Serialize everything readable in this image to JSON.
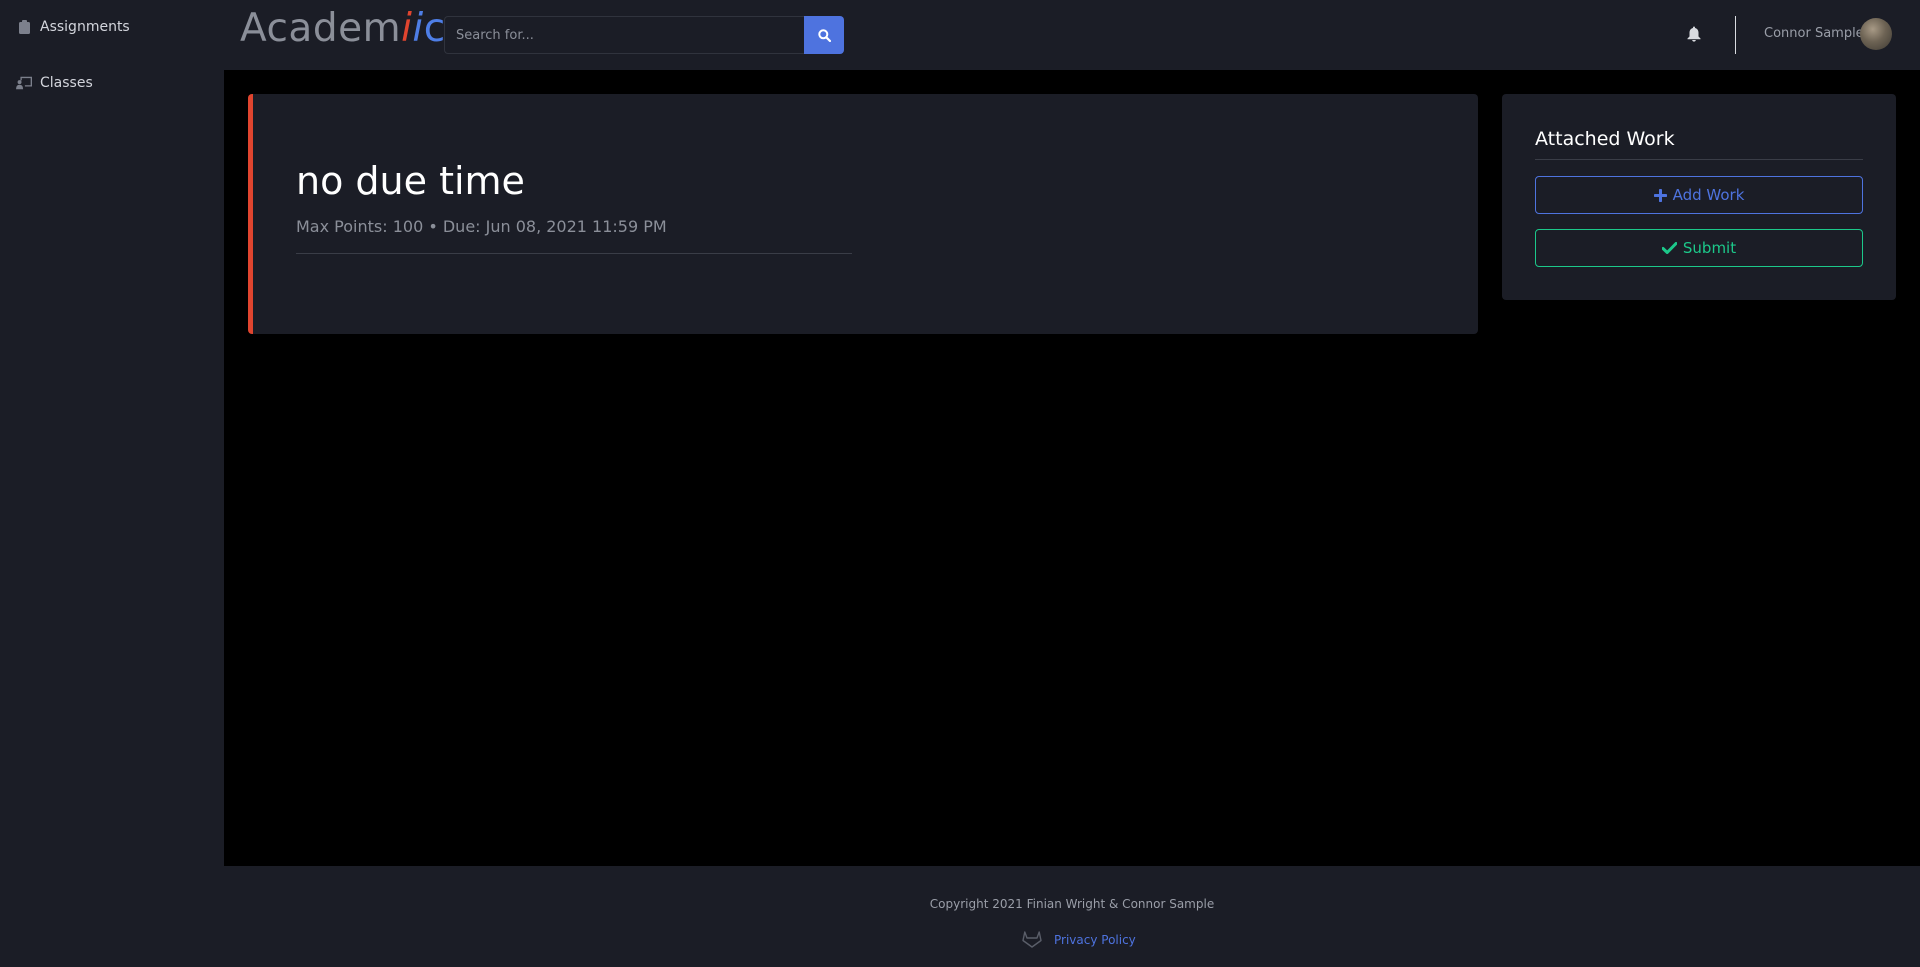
{
  "sidebar": {
    "items": [
      {
        "label": "Assignments",
        "icon": "clipboard-icon"
      },
      {
        "label": "Classes",
        "icon": "chalkboard-teacher-icon"
      }
    ]
  },
  "header": {
    "logo": {
      "part1": "Academ",
      "part2": "i",
      "part3": "i",
      "part4": "c"
    },
    "search": {
      "placeholder": "Search for..."
    },
    "user_name": "Connor Sample"
  },
  "assignment": {
    "title": "no due time",
    "meta": "Max Points: 100 • Due: Jun 08, 2021 11:59 PM",
    "accent_color": "#e0452f"
  },
  "attached_work": {
    "title": "Attached Work",
    "add_label": "Add Work",
    "submit_label": "Submit"
  },
  "footer": {
    "copyright": "Copyright 2021 Finian Wright & Connor Sample",
    "privacy_label": "Privacy Policy"
  },
  "colors": {
    "primary": "#4e73df",
    "success": "#1cc88a",
    "danger": "#e0452f",
    "background": "#1b1d26"
  }
}
